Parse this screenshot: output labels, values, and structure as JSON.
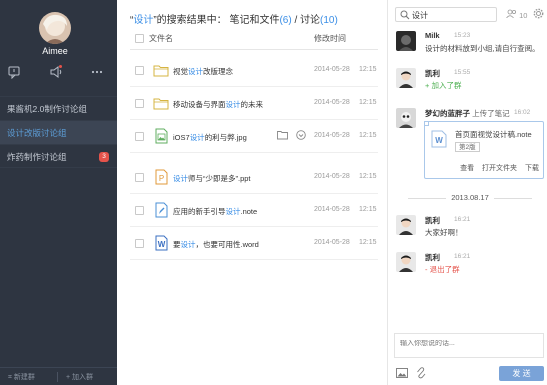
{
  "sidebar": {
    "username": "Aimee",
    "groups": [
      {
        "label": "果酱机2.0制作讨论组",
        "active": false,
        "badge": ""
      },
      {
        "label": "设计改版讨论组",
        "active": true,
        "badge": ""
      },
      {
        "label": "炸药制作讨论组",
        "active": false,
        "badge": "3"
      }
    ],
    "new_group_label": "新建群",
    "join_group_label": "加入群"
  },
  "search": {
    "title_open": "“",
    "keyword": "设计",
    "title_mid": "”的搜索结果中： 笔记和文件",
    "files_count": "(6)",
    "separator": " / 讨论",
    "discussion_count": "(10)"
  },
  "file_list": {
    "col_name": "文件名",
    "col_time": "修改时间",
    "rows": [
      {
        "icon": "folder-icon",
        "pre": "视觉",
        "hl": "设计",
        "post": "改版理念",
        "date": "2014-05-28",
        "time": "12:15"
      },
      {
        "icon": "folder-icon",
        "pre": "移动设备与界面",
        "hl": "设计",
        "post": "的未来",
        "date": "2014-05-28",
        "time": "12:15"
      },
      {
        "icon": "image-icon",
        "pre": "iOS7",
        "hl": "设计",
        "post": "的利与弊.jpg",
        "date": "2014-05-28",
        "time": "12:15"
      },
      {
        "icon": "ppt-icon",
        "pre": "",
        "hl": "设计",
        "post": "师与“少即是多”.ppt",
        "date": "2014-05-28",
        "time": "12:15"
      },
      {
        "icon": "note-icon",
        "pre": "应用的新手引导",
        "hl": "设计",
        "post": ".note",
        "date": "2014-05-28",
        "time": "12:15"
      },
      {
        "icon": "word-icon",
        "pre": "要",
        "hl": "设计",
        "post": "，也要可用性.word",
        "date": "2014-05-28",
        "time": "12:15"
      }
    ]
  },
  "chat": {
    "search_value": "设计",
    "member_count": "10",
    "messages": [
      {
        "name": "Milk",
        "time": "15:23",
        "text": "设计的材料放到小组,请自行查阅。"
      },
      {
        "name": "凯利",
        "time": "15:55",
        "text": "+ 加入了群"
      },
      {
        "name": "梦幻的蓝胖子",
        "action": "上传了笔记",
        "time": "16:02"
      },
      {
        "name": "凯利",
        "time": "16:21",
        "text": "大家好啊！"
      },
      {
        "name": "凯利",
        "time": "16:21",
        "text": "- 退出了群"
      }
    ],
    "note": {
      "title": "首页面视觉设计稿.note",
      "version": "第2版",
      "view": "查看",
      "open_folder": "打开文件夹",
      "download": "下载"
    },
    "date_separator": "2013.08.17",
    "input_placeholder": "输入你想说的话...",
    "send_label": "发 送"
  },
  "colors": {
    "sidebar_bg": "#2e3541",
    "accent": "#3a8ee6",
    "send_bg": "#7aa3d8",
    "badge": "#e5534b"
  }
}
